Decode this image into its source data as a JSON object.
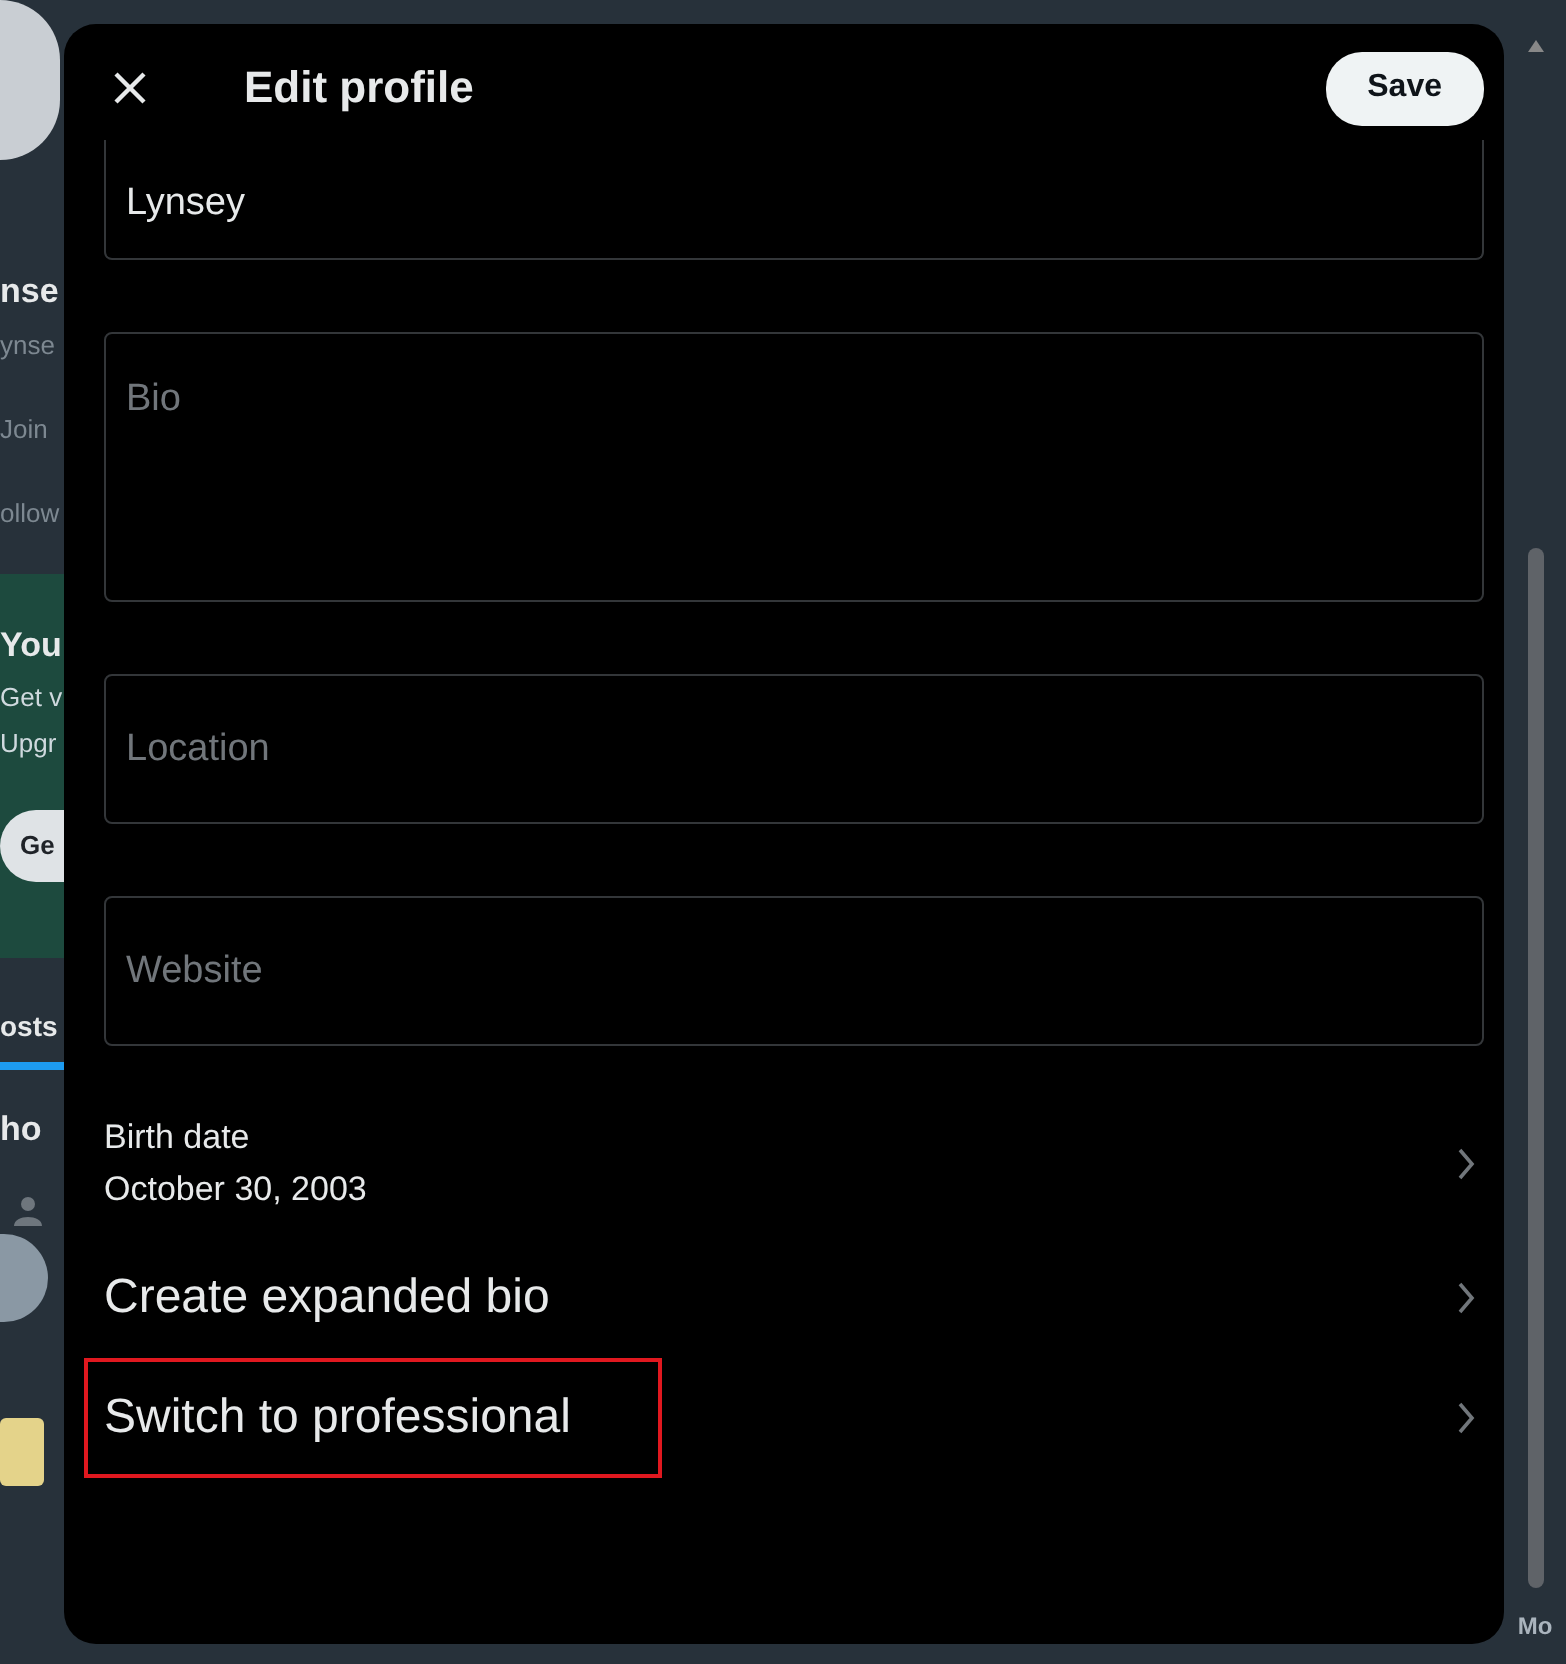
{
  "background_page": {
    "profile_name": "nse",
    "handle": "ynse",
    "joined": "Join",
    "follow": "ollow",
    "promo": {
      "title": "You",
      "lines": [
        "Get v",
        "Upgr"
      ],
      "button": "Ge"
    },
    "tabs": [
      {
        "label": "osts",
        "selected": true
      }
    ],
    "section_title": "ho",
    "right_label": "Mo"
  },
  "dialog": {
    "title": "Edit profile",
    "save_button": "Save",
    "fields": [
      {
        "value": "Lynsey",
        "kind": "line"
      },
      {
        "placeholder": "Bio",
        "kind": "area"
      },
      {
        "placeholder": "Location",
        "kind": "line"
      },
      {
        "placeholder": "Website",
        "kind": "line"
      }
    ],
    "birth_date": {
      "label": "Birth date",
      "value": "October 30, 2003"
    },
    "links": [
      {
        "label": "Create expanded bio",
        "highlighted": false
      },
      {
        "label": "Switch to professional",
        "highlighted": true
      }
    ]
  }
}
